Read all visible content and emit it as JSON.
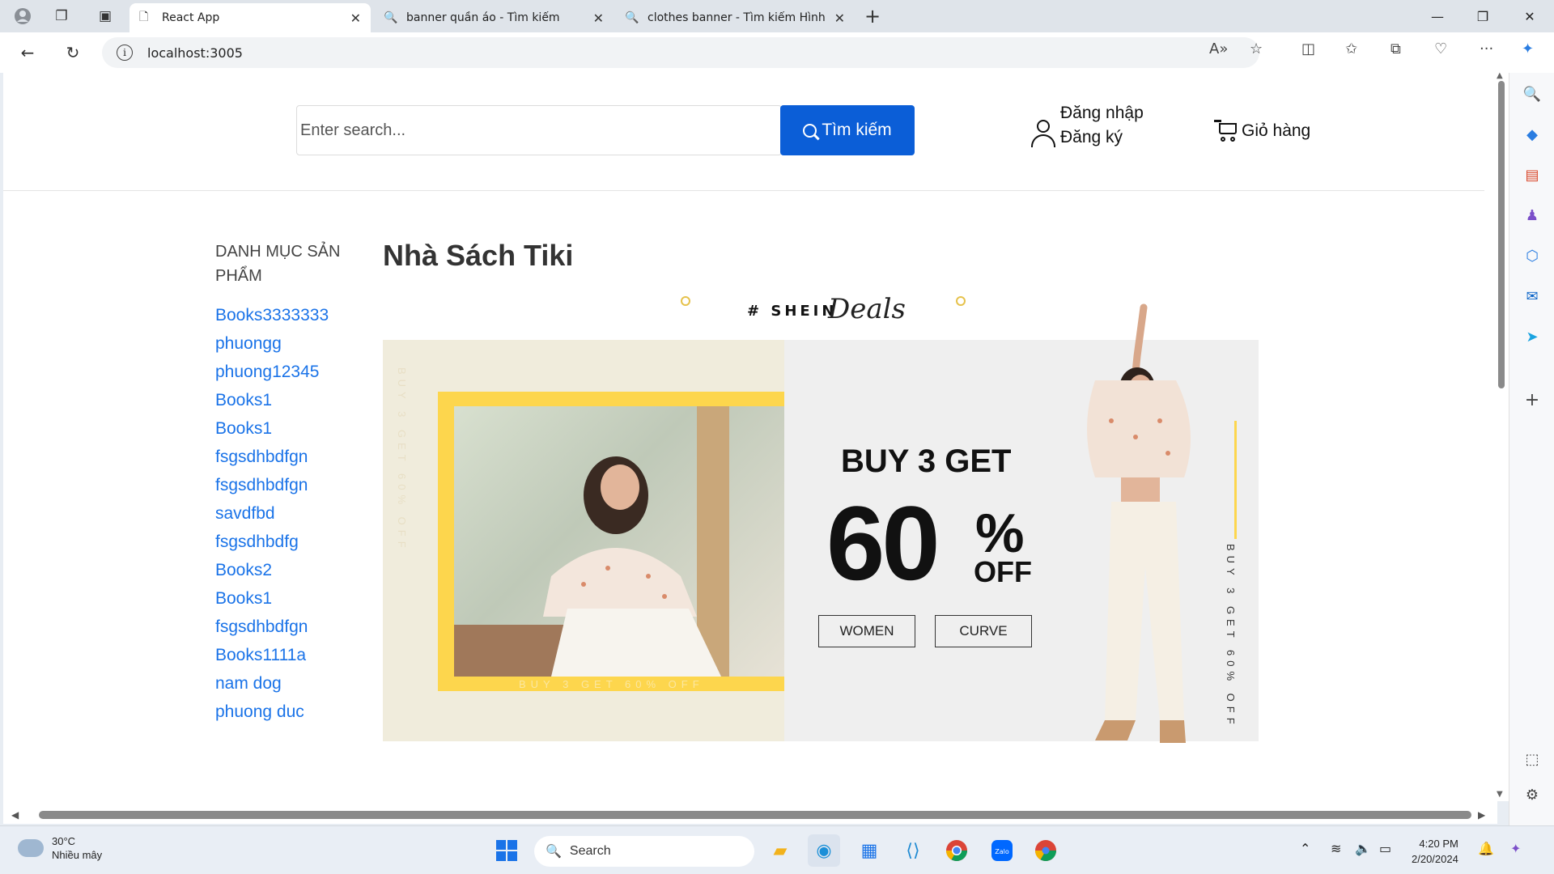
{
  "browser": {
    "tabs": [
      {
        "title": "React App",
        "icon": "page-icon",
        "active": true
      },
      {
        "title": "banner quần áo - Tìm kiếm",
        "icon": "search-icon",
        "active": false
      },
      {
        "title": "clothes banner - Tìm kiếm Hình ả",
        "icon": "search-icon",
        "active": false
      }
    ],
    "url": "localhost:3005"
  },
  "header": {
    "search_placeholder": "Enter search...",
    "search_button": "Tìm kiếm",
    "login": "Đăng nhập",
    "register": "Đăng ký",
    "cart": "Giỏ hàng"
  },
  "sidebar": {
    "title": "DANH MỤC SẢN PHẨM",
    "items": [
      "Books3333333",
      "phuongg",
      "phuong12345",
      "Books1",
      "Books1",
      "fsgsdhbdfgn",
      "fsgsdhbdfgn",
      "savdfbd",
      "fsgsdhbdfg",
      "Books2",
      "Books1",
      "fsgsdhbdfgn",
      "Books1111a",
      "nam dog",
      "phuong duc"
    ]
  },
  "main": {
    "title": "Nhà Sách Tiki",
    "banner": {
      "brand": "# SHEIN",
      "brand_script": "Deals",
      "headline": "BUY 3 GET",
      "percent": "60",
      "percent_sign": "%",
      "off": "OFF",
      "buttons": [
        "WOMEN",
        "CURVE"
      ],
      "vertical_text": "BUY 3 GET 60% OFF",
      "frame_caption": "BUY 3 GET 60% OFF",
      "side_caption": "BUY 3 GET 60% OFF",
      "accent_color": "#fdd64d"
    }
  },
  "taskbar": {
    "weather_temp": "30°C",
    "weather_desc": "Nhiều mây",
    "search": "Search",
    "time": "4:20 PM",
    "date": "2/20/2024"
  }
}
